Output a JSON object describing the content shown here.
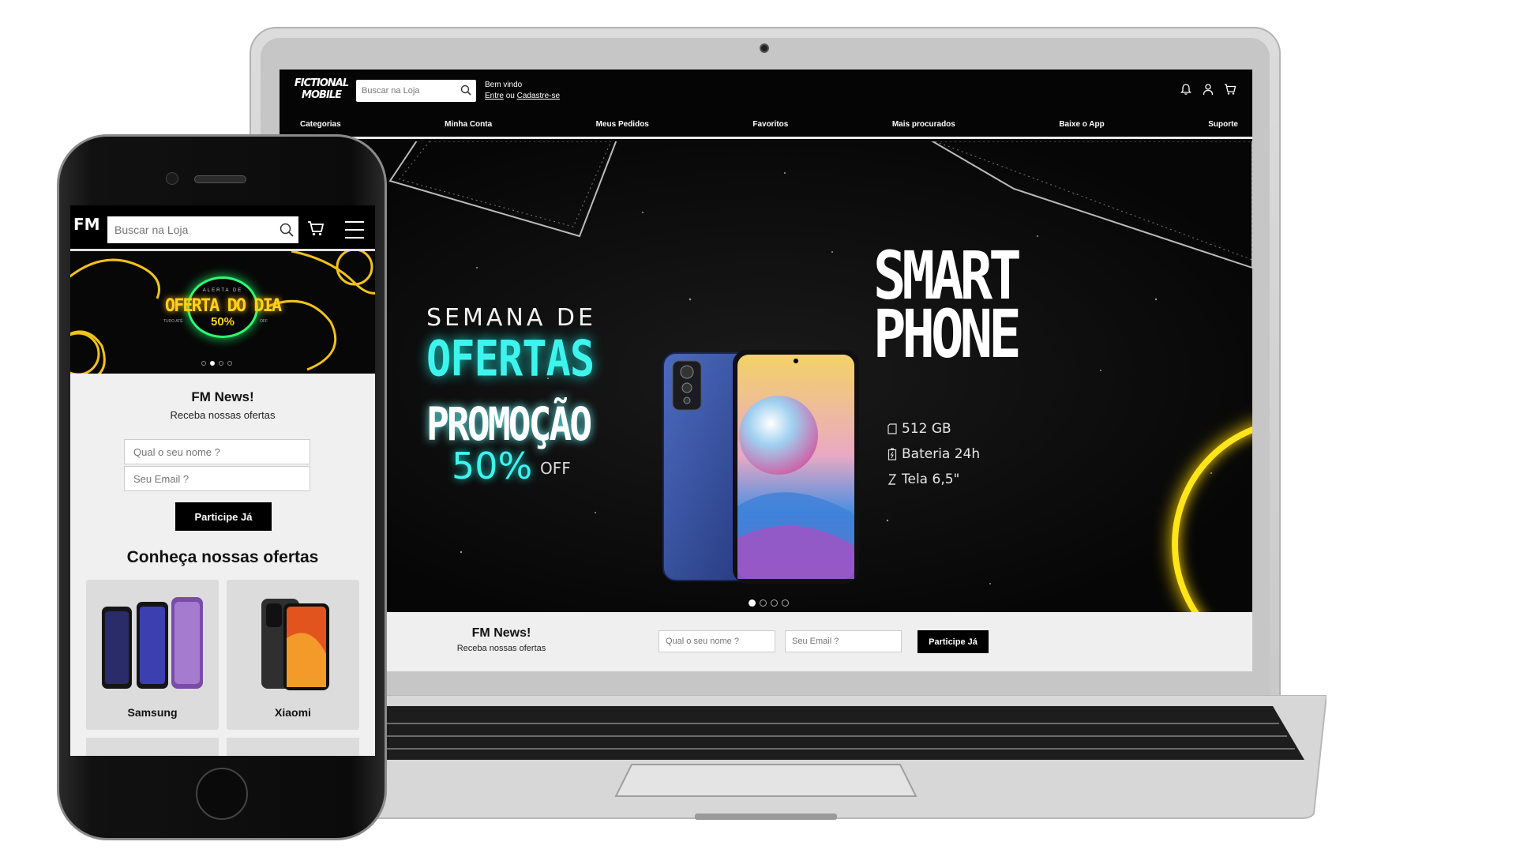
{
  "laptop": {
    "logo_line1": "FICTIONAL",
    "logo_line2": "MOBILE",
    "search": {
      "placeholder": "Buscar na Loja"
    },
    "welcome": {
      "line1": "Bem vindo",
      "login": "Entre",
      "or": "ou",
      "signup": "Cadastre-se"
    },
    "nav": [
      "Categorias",
      "Minha Conta",
      "Meus Pedidos",
      "Favoritos",
      "Mais procurados",
      "Baixe o App",
      "Suporte"
    ],
    "hero": {
      "semana": "SEMANA DE",
      "ofertas": "OFERTAS",
      "promocao": "PROMOÇÃO",
      "percent": "50%",
      "off": "OFF",
      "smart": "SMART",
      "phone": "PHONE",
      "specs": [
        "512 GB",
        "Bateria 24h",
        "Tela 6,5\""
      ],
      "slides": 4,
      "active_slide": 1
    },
    "newsletter": {
      "title": "FM News!",
      "subtitle": "Receba nossas ofertas",
      "name_placeholder": "Qual o seu nome ?",
      "email_placeholder": "Seu Email ?",
      "button": "Participe Já"
    }
  },
  "phone": {
    "logo": "FM",
    "search": {
      "placeholder": "Buscar na Loja"
    },
    "banner": {
      "alerta": "ALERTA DE",
      "oferta": "OFERTA DO DIA",
      "percent": "50%",
      "tudo": "TUDO ATÉ",
      "off": "OFF",
      "slides": 4,
      "active_slide": 2
    },
    "newsletter": {
      "title": "FM News!",
      "subtitle": "Receba nossas ofertas",
      "name_placeholder": "Qual o seu nome ?",
      "email_placeholder": "Seu Email ?",
      "button": "Participe Já"
    },
    "offers_title": "Conheça nossas ofertas",
    "brands": [
      "Samsung",
      "Xiaomi"
    ]
  },
  "colors": {
    "accent_cyan": "#3ef5ee",
    "accent_yellow": "#ffe51a",
    "accent_green": "#2dff72",
    "header_bg": "#000000"
  }
}
